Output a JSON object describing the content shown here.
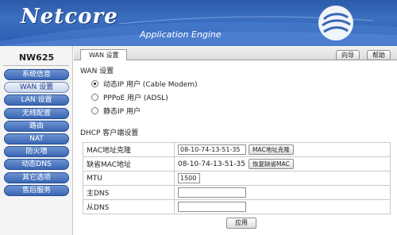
{
  "header": {
    "logo": "Netcore",
    "subtitle": "Application Engine"
  },
  "sidebar": {
    "model": "NW625",
    "items": [
      {
        "label": "系统信息"
      },
      {
        "label": "WAN 设置"
      },
      {
        "label": "LAN 设置"
      },
      {
        "label": "无线配置"
      },
      {
        "label": "路由"
      },
      {
        "label": "NAT"
      },
      {
        "label": "防火墙"
      },
      {
        "label": "动态DNS"
      },
      {
        "label": "其它选项"
      },
      {
        "label": "售后服务"
      }
    ],
    "active_index": 1
  },
  "tabs": {
    "active": "WAN 设置"
  },
  "toolbar": {
    "wizard": "向导",
    "help": "帮助"
  },
  "wan": {
    "title": "WAN 设置",
    "options": [
      {
        "label": "动态IP 用户 (Cable Modem)",
        "checked": true
      },
      {
        "label": "PPPoE 用户 (ADSL)",
        "checked": false
      },
      {
        "label": "静态IP 用户",
        "checked": false
      }
    ]
  },
  "dhcp": {
    "title": "DHCP 客户端设置",
    "mac_clone_label": "MAC地址克隆",
    "mac_clone_value": "08-10-74-13-51-35",
    "mac_clone_button": "MAC地址克隆",
    "default_mac_label": "缺省MAC地址",
    "default_mac_value": "08-10-74-13-51-35",
    "restore_mac_button": "恢复缺省MAC",
    "mtu_label": "MTU",
    "mtu_value": "1500",
    "dns1_label": "主DNS",
    "dns1_value": "",
    "dns2_label": "从DNS",
    "dns2_value": "",
    "apply_button": "应用"
  },
  "colors": {
    "header_blue": "#2c5bb0",
    "nav_blue": "#3a66b4"
  }
}
